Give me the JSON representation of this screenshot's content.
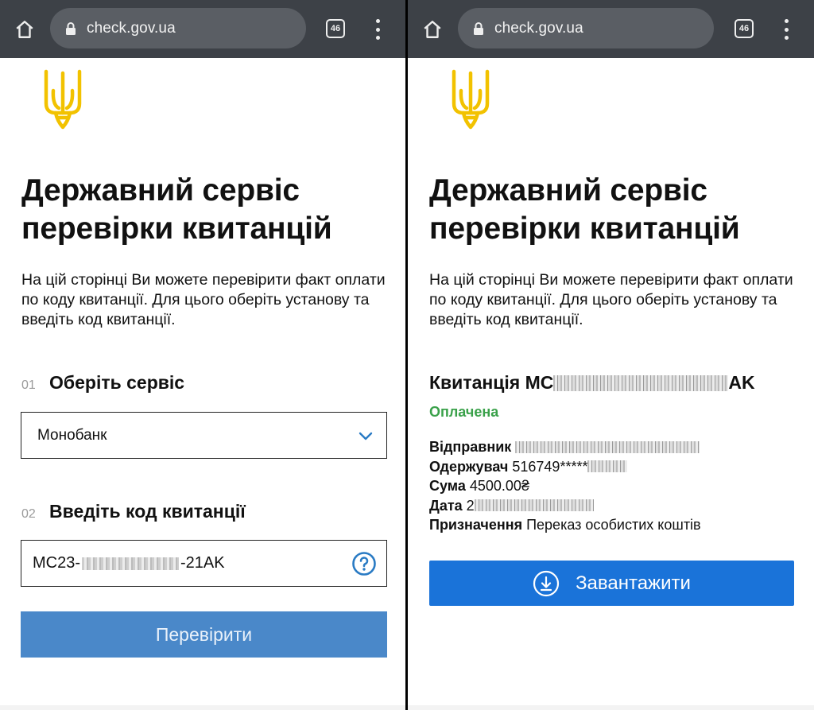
{
  "browser": {
    "url": "check.gov.ua",
    "tab_count": "46"
  },
  "page": {
    "title": "Державний сервіс перевірки квитанцій",
    "description": "На цій сторінці Ви можете перевірити факт оплати по коду квитанції. Для цього оберіть установу та введіть код квитанції."
  },
  "form": {
    "step1_number": "01",
    "step1_label": "Оберіть сервіс",
    "service_selected": "Монобанк",
    "step2_number": "02",
    "step2_label": "Введіть код квитанції",
    "code_prefix": "MC23-",
    "code_suffix": "-21AK",
    "submit_label": "Перевірити"
  },
  "receipt": {
    "title_prefix": "Квитанція MC",
    "title_suffix": "AK",
    "status": "Оплачена",
    "sender_label": "Відправник",
    "recipient_label": "Одержувач",
    "recipient_value": "516749*****",
    "amount_label": "Сума",
    "amount_value": "4500.00₴",
    "date_label": "Дата",
    "date_value": "2",
    "purpose_label": "Призначення",
    "purpose_value": "Переказ особистих коштів",
    "download_label": "Завантажити"
  },
  "colors": {
    "browser_bar": "#3d4147",
    "check_button": "#4a88c9",
    "download_button": "#1a73d9",
    "status_paid": "#3aa14a",
    "trident": "#f2c200"
  }
}
